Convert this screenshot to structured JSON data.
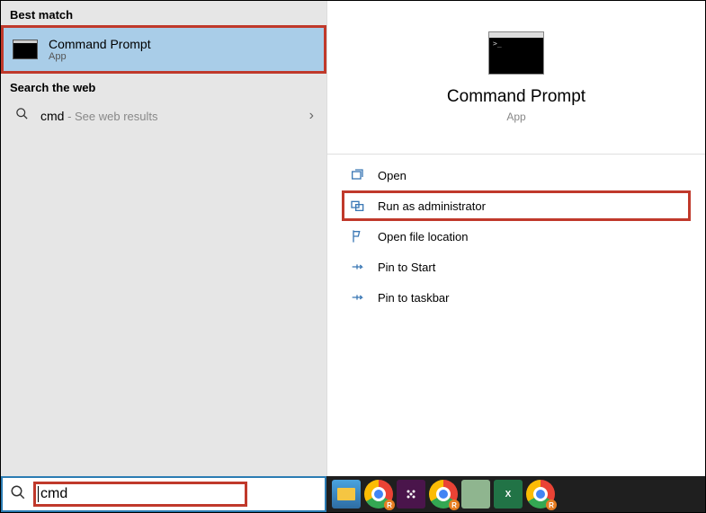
{
  "leftPanel": {
    "bestMatchHeader": "Best match",
    "bestMatch": {
      "title": "Command Prompt",
      "subtitle": "App"
    },
    "searchWebHeader": "Search the web",
    "webResult": {
      "query": "cmd",
      "suffix": " - See web results"
    }
  },
  "detail": {
    "title": "Command Prompt",
    "subtitle": "App",
    "actions": {
      "open": "Open",
      "runAdmin": "Run as administrator",
      "openLocation": "Open file location",
      "pinStart": "Pin to Start",
      "pinTaskbar": "Pin to taskbar"
    }
  },
  "searchBox": {
    "value": "cmd"
  },
  "taskbar": {
    "items": [
      "file-explorer",
      "chrome",
      "slack",
      "chrome-2",
      "app",
      "excel",
      "chrome-3"
    ]
  }
}
